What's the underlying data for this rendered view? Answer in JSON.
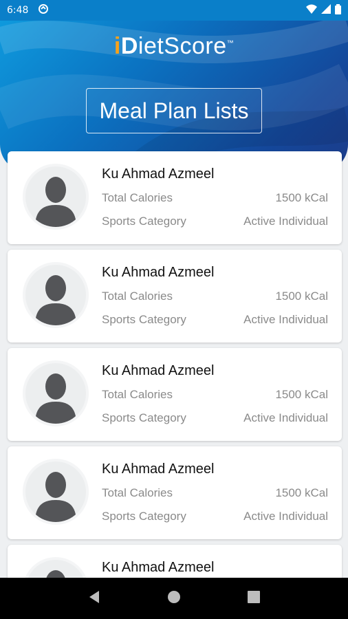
{
  "status_bar": {
    "time": "6:48"
  },
  "header": {
    "logo": {
      "i": "i",
      "d": "D",
      "rest": "ietScore",
      "tm": "™"
    },
    "title": "Meal Plan Lists"
  },
  "cards": [
    {
      "name": "Ku Ahmad Azmeel",
      "calories_label": "Total Calories",
      "calories_value": "1500 kCal",
      "category_label": "Sports Category",
      "category_value": "Active Individual"
    },
    {
      "name": "Ku Ahmad Azmeel",
      "calories_label": "Total Calories",
      "calories_value": "1500 kCal",
      "category_label": "Sports Category",
      "category_value": "Active Individual"
    },
    {
      "name": "Ku Ahmad Azmeel",
      "calories_label": "Total Calories",
      "calories_value": "1500 kCal",
      "category_label": "Sports Category",
      "category_value": "Active Individual"
    },
    {
      "name": "Ku Ahmad Azmeel",
      "calories_label": "Total Calories",
      "calories_value": "1500 kCal",
      "category_label": "Sports Category",
      "category_value": "Active Individual"
    },
    {
      "name": "Ku Ahmad Azmeel"
    }
  ],
  "icons": {
    "status": [
      "sync-icon",
      "wifi-icon",
      "signal-icon",
      "battery-icon"
    ],
    "nav": [
      "back-icon",
      "home-icon",
      "recents-icon"
    ]
  },
  "colors": {
    "header_start": "#0f9ee0",
    "header_end": "#1c3c8a",
    "logo_accent": "#f7a21b"
  }
}
